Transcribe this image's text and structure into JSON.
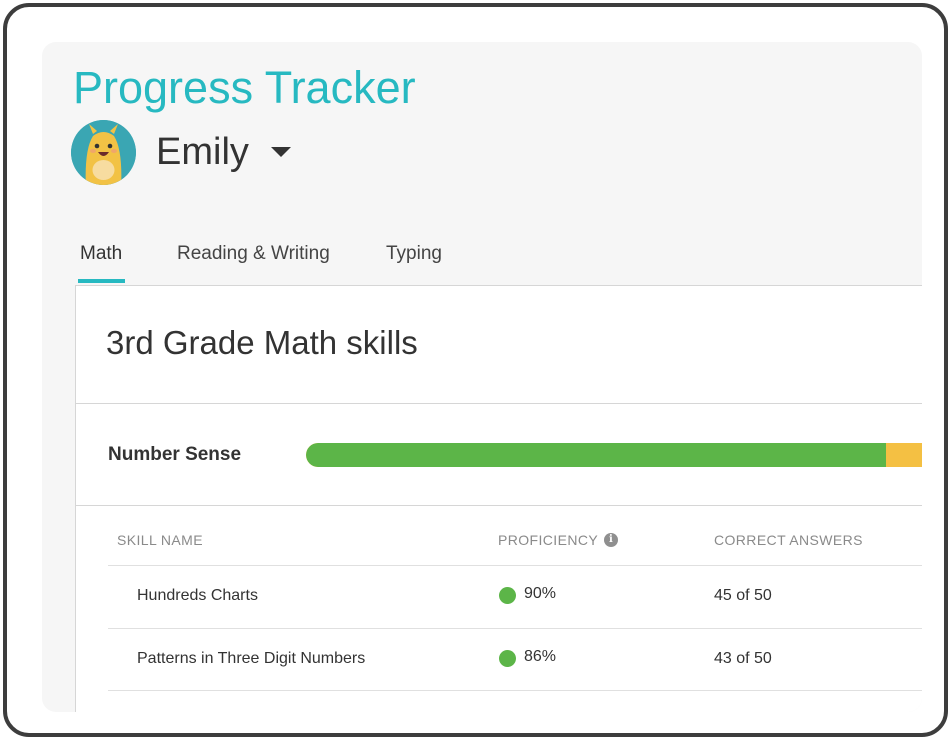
{
  "header": {
    "title": "Progress Tracker",
    "user_name": "Emily"
  },
  "tabs": [
    {
      "label": "Math",
      "active": true
    },
    {
      "label": "Reading & Writing",
      "active": false
    },
    {
      "label": "Typing",
      "active": false
    }
  ],
  "card": {
    "title": "3rd Grade Math skills",
    "area": {
      "label": "Number Sense",
      "progress_green": 0.906,
      "colors": {
        "mastered": "#5cb548",
        "in_progress": "#f4c043"
      }
    },
    "table": {
      "headers": {
        "skill_name": "SKILL NAME",
        "proficiency": "PROFICIENCY",
        "correct_answers": "CORRECT ANSWERS"
      },
      "info_icon": "info-icon",
      "rows": [
        {
          "skill": "Hundreds Charts",
          "proficiency": "90%",
          "correct": "45 of 50",
          "status_color": "#5cb548"
        },
        {
          "skill": "Patterns in Three Digit Numbers",
          "proficiency": "86%",
          "correct": "43 of 50",
          "status_color": "#5cb548"
        }
      ]
    }
  },
  "colors": {
    "accent": "#27b9c1",
    "frame": "#3d3d3d"
  }
}
